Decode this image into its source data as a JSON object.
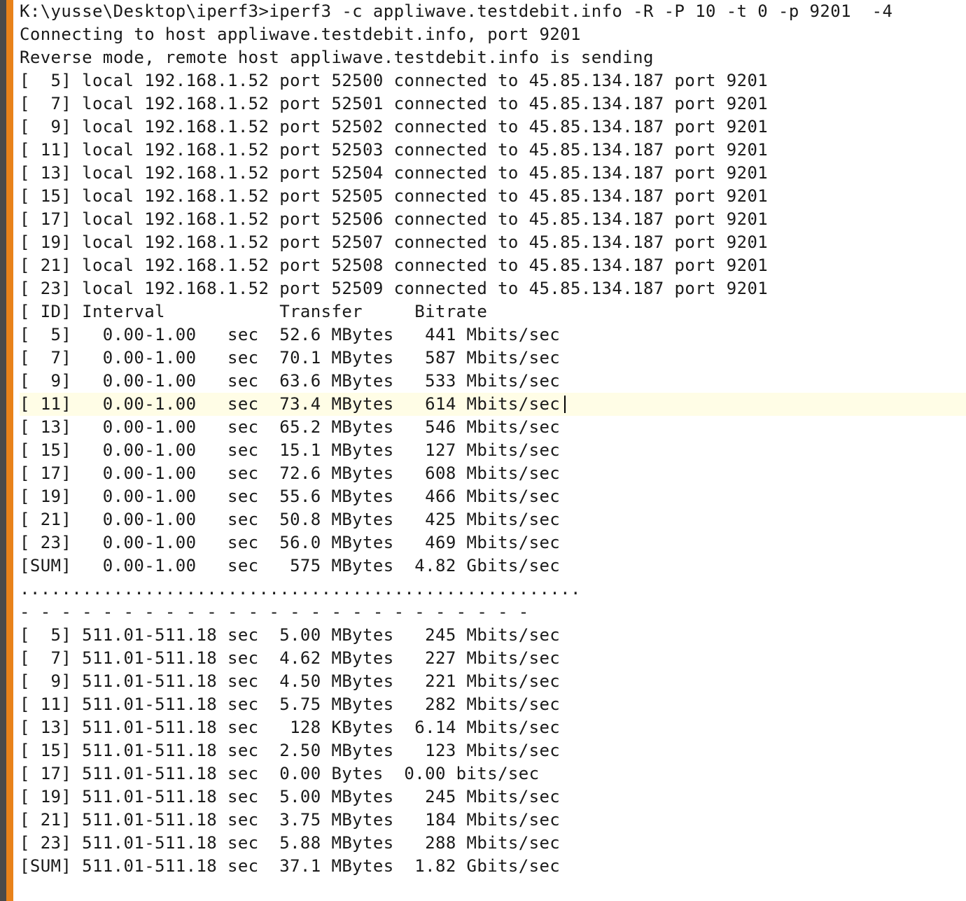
{
  "editor": {
    "accent_color": "#e8821a",
    "current_line_color": "#fffde6",
    "lines": [
      "K:\\yusse\\Desktop\\iperf3>iperf3 -c appliwave.testdebit.info -R -P 10 -t 0 -p 9201  -4",
      "Connecting to host appliwave.testdebit.info, port 9201",
      "Reverse mode, remote host appliwave.testdebit.info is sending",
      "[  5] local 192.168.1.52 port 52500 connected to 45.85.134.187 port 9201",
      "[  7] local 192.168.1.52 port 52501 connected to 45.85.134.187 port 9201",
      "[  9] local 192.168.1.52 port 52502 connected to 45.85.134.187 port 9201",
      "[ 11] local 192.168.1.52 port 52503 connected to 45.85.134.187 port 9201",
      "[ 13] local 192.168.1.52 port 52504 connected to 45.85.134.187 port 9201",
      "[ 15] local 192.168.1.52 port 52505 connected to 45.85.134.187 port 9201",
      "[ 17] local 192.168.1.52 port 52506 connected to 45.85.134.187 port 9201",
      "[ 19] local 192.168.1.52 port 52507 connected to 45.85.134.187 port 9201",
      "[ 21] local 192.168.1.52 port 52508 connected to 45.85.134.187 port 9201",
      "[ 23] local 192.168.1.52 port 52509 connected to 45.85.134.187 port 9201",
      "[ ID] Interval           Transfer     Bitrate",
      "[  5]   0.00-1.00   sec  52.6 MBytes   441 Mbits/sec",
      "[  7]   0.00-1.00   sec  70.1 MBytes   587 Mbits/sec",
      "[  9]   0.00-1.00   sec  63.6 MBytes   533 Mbits/sec",
      "[ 11]   0.00-1.00   sec  73.4 MBytes   614 Mbits/sec",
      "[ 13]   0.00-1.00   sec  65.2 MBytes   546 Mbits/sec",
      "[ 15]   0.00-1.00   sec  15.1 MBytes   127 Mbits/sec",
      "[ 17]   0.00-1.00   sec  72.6 MBytes   608 Mbits/sec",
      "[ 19]   0.00-1.00   sec  55.6 MBytes   466 Mbits/sec",
      "[ 21]   0.00-1.00   sec  50.8 MBytes   425 Mbits/sec",
      "[ 23]   0.00-1.00   sec  56.0 MBytes   469 Mbits/sec",
      "[SUM]   0.00-1.00   sec   575 MBytes  4.82 Gbits/sec",
      "......................................................",
      "- - - - - - - - - - - - - - - - - - - - - - - - -",
      "[  5] 511.01-511.18 sec  5.00 MBytes   245 Mbits/sec",
      "[  7] 511.01-511.18 sec  4.62 MBytes   227 Mbits/sec",
      "[  9] 511.01-511.18 sec  4.50 MBytes   221 Mbits/sec",
      "[ 11] 511.01-511.18 sec  5.75 MBytes   282 Mbits/sec",
      "[ 13] 511.01-511.18 sec   128 KBytes  6.14 Mbits/sec",
      "[ 15] 511.01-511.18 sec  2.50 MBytes   123 Mbits/sec",
      "[ 17] 511.01-511.18 sec  0.00 Bytes  0.00 bits/sec",
      "[ 19] 511.01-511.18 sec  5.00 MBytes   245 Mbits/sec",
      "[ 21] 511.01-511.18 sec  3.75 MBytes   184 Mbits/sec",
      "[ 23] 511.01-511.18 sec  5.88 MBytes   288 Mbits/sec",
      "[SUM] 511.01-511.18 sec  37.1 MBytes  1.82 Gbits/sec"
    ]
  }
}
